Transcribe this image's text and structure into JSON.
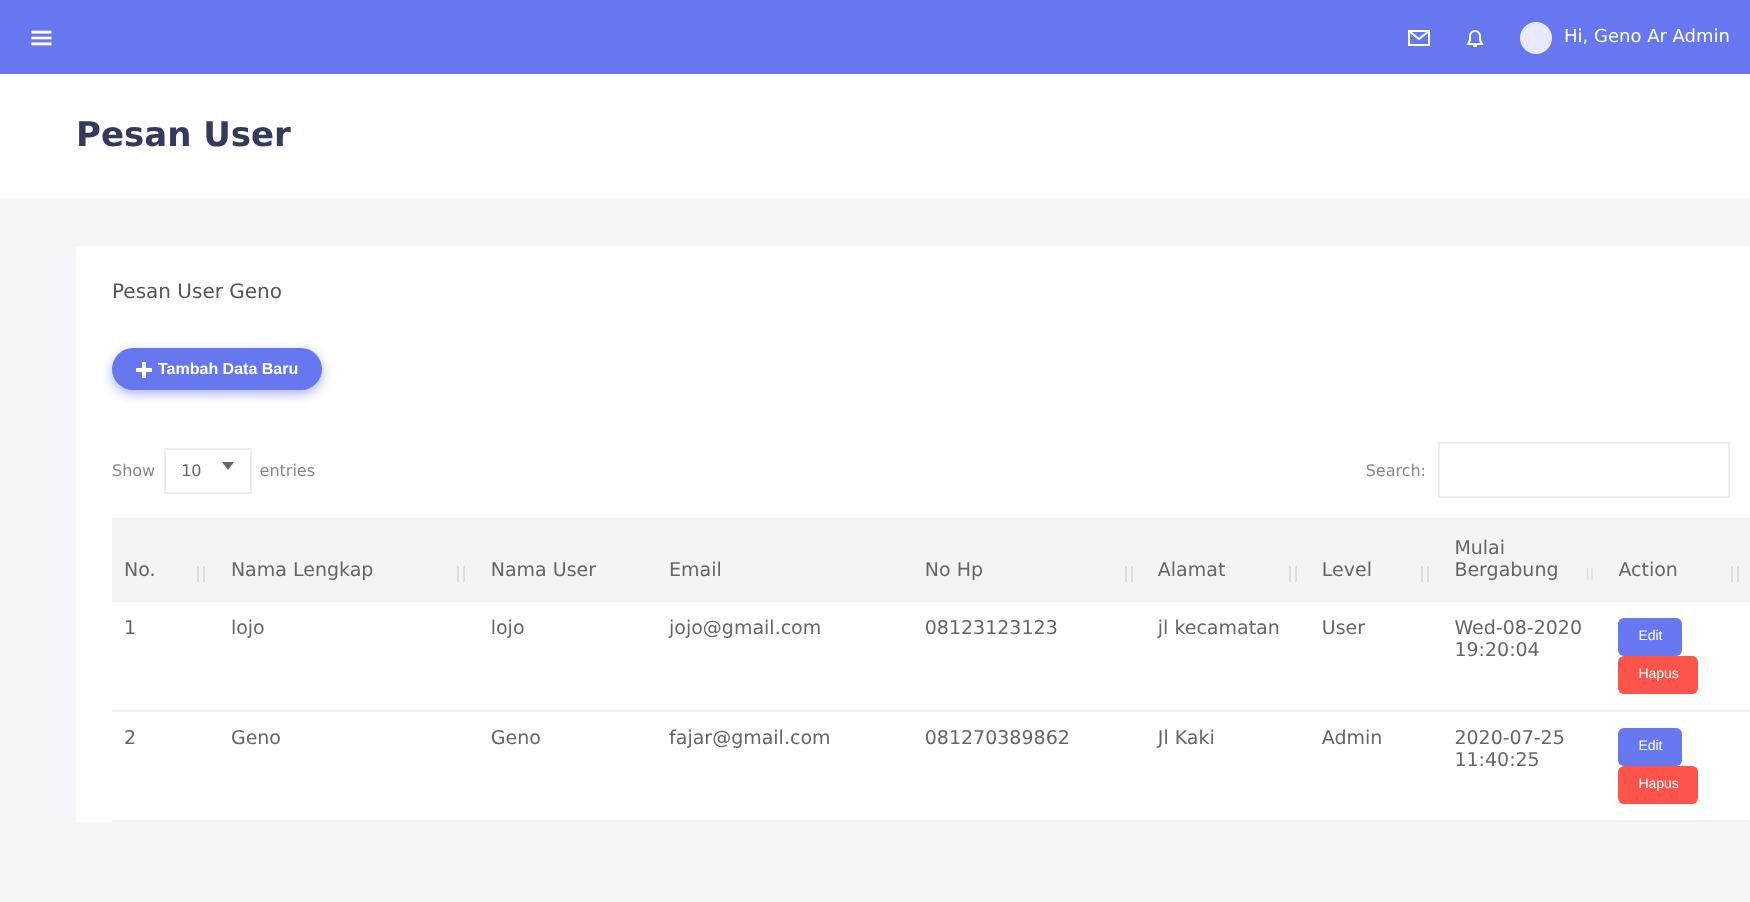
{
  "topbar": {
    "menu": "≡",
    "greeting": "Hi, Geno Ar Admin"
  },
  "page_title": "Pesan User",
  "card": {
    "title": "Pesan User Geno",
    "add_button": "Tambah Data Baru",
    "length": {
      "show": "Show",
      "value": "10",
      "entries": "entries"
    },
    "search": {
      "label": "Search:"
    },
    "table": {
      "columns": [
        {
          "label": "No.",
          "sortable": true
        },
        {
          "label": "Nama Lengkap",
          "sortable": true
        },
        {
          "label": "Nama User",
          "sortable": false
        },
        {
          "label": "Email",
          "sortable": false
        },
        {
          "label": "No Hp",
          "sortable": true
        },
        {
          "label": "Alamat",
          "sortable": true
        },
        {
          "label": "Level",
          "sortable": true
        },
        {
          "label": "Mulai Bergabung",
          "sortable": true
        },
        {
          "label": "Action",
          "sortable": true
        }
      ],
      "rows": [
        {
          "cells": [
            "1",
            "lojo",
            "lojo",
            "jojo@gmail.com",
            "08123123123",
            "jl kecamatan",
            "User",
            "Wed-08-2020 19:20:04"
          ],
          "actions": [
            "Edit",
            "Hapus"
          ]
        },
        {
          "cells": [
            "2",
            "Geno",
            "Geno",
            "fajar@gmail.com",
            "081270389862",
            "Jl Kaki",
            "Admin",
            "2020-07-25 11:40:25"
          ],
          "actions": [
            "Edit",
            "Hapus"
          ]
        }
      ]
    }
  }
}
